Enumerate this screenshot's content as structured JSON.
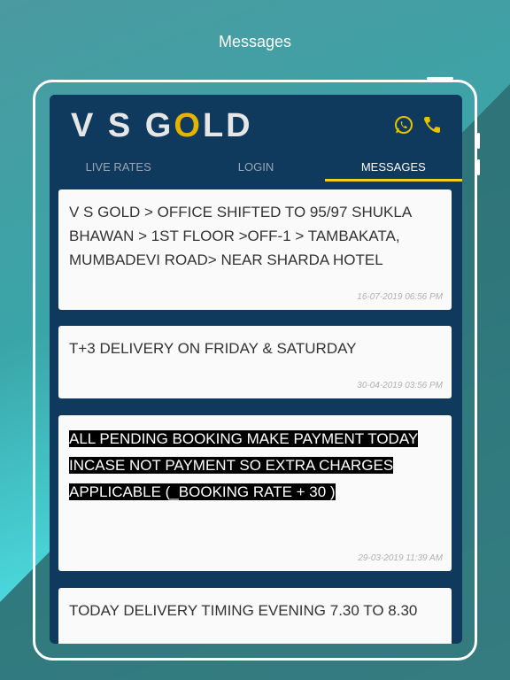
{
  "page_title": "Messages",
  "app": {
    "logo_text_1": "V S G",
    "logo_text_o": "O",
    "logo_text_2": "LD",
    "icons": [
      "whatsapp-icon",
      "phone-icon"
    ],
    "accent_color": "#e6b400"
  },
  "tabs": [
    {
      "label": "LIVE RATES",
      "active": false
    },
    {
      "label": "LOGIN",
      "active": false
    },
    {
      "label": "MESSAGES",
      "active": true
    }
  ],
  "messages": [
    {
      "text": "V S GOLD > OFFICE SHIFTED TO 95/97 SHUKLA BHAWAN > 1ST FLOOR >OFF-1 > TAMBAKATA, MUMBADEVI ROAD> NEAR SHARDA HOTEL",
      "time": "16-07-2019 06:56 PM"
    },
    {
      "text": "T+3 DELIVERY ON  FRIDAY & SATURDAY",
      "time": "30-04-2019 03:56 PM"
    },
    {
      "text": "ALL PENDING BOOKING MAKE PAYMENT TODAY INCASE NOT PAYMENT SO EXTRA CHARGES APPLICABLE (_BOOKING RATE + 30 )",
      "time": "29-03-2019 11:39 AM"
    },
    {
      "text": "TODAY DELIVERY TIMING EVENING 7.30 TO 8.30",
      "time": ""
    }
  ]
}
